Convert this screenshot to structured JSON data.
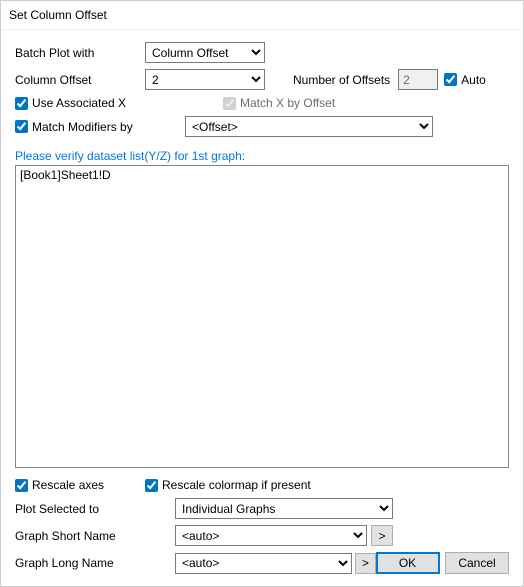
{
  "title": "Set Column Offset",
  "labels": {
    "batch_plot_with": "Batch Plot with",
    "column_offset": "Column Offset",
    "number_of_offsets": "Number of Offsets",
    "auto": "Auto",
    "use_associated_x": "Use Associated X",
    "match_x_by_offset": "Match X by Offset",
    "match_modifiers_by": "Match Modifiers by",
    "verify_hint": "Please verify dataset list(Y/Z) for 1st graph:",
    "rescale_axes": "Rescale axes",
    "rescale_colormap": "Rescale colormap if present",
    "plot_selected_to": "Plot Selected to",
    "graph_short_name": "Graph Short Name",
    "graph_long_name": "Graph Long Name",
    "ok": "OK",
    "cancel": "Cancel",
    "more": ">"
  },
  "values": {
    "batch_plot_with": "Column Offset",
    "column_offset": "2",
    "number_of_offsets": "2",
    "auto_checked": true,
    "use_associated_x_checked": true,
    "match_x_by_offset_checked": true,
    "match_modifiers_checked": true,
    "match_modifiers_by": "<Offset>",
    "dataset_list_item": "[Book1]Sheet1!D",
    "rescale_axes_checked": true,
    "rescale_colormap_checked": true,
    "plot_selected_to": "Individual Graphs",
    "graph_short_name": "<auto>",
    "graph_long_name": "<auto>"
  }
}
